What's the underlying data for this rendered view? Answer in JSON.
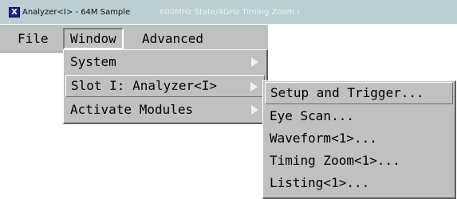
{
  "titlebar": {
    "title": "Analyzer<I> - 64M Sample",
    "subtitle": "600MHz State/4GHz Timing Zoom I",
    "icon": "x-window-icon",
    "colors": {
      "background": "#b9cfd1",
      "icon_bg": "#1a1f8a"
    }
  },
  "menubar": {
    "items": [
      {
        "label": "File"
      },
      {
        "label": "Window",
        "state": "open"
      },
      {
        "label": "Advanced"
      }
    ]
  },
  "window_menu": {
    "items": [
      {
        "label": "System",
        "has_submenu": true
      },
      {
        "label": "Slot I: Analyzer<I>",
        "has_submenu": true,
        "state": "open"
      },
      {
        "label": "Activate Modules",
        "has_submenu": true
      }
    ]
  },
  "slot_submenu": {
    "items": [
      {
        "label": "Setup and Trigger...",
        "state": "highlighted"
      },
      {
        "label": "Eye Scan..."
      },
      {
        "label": "Waveform<1>..."
      },
      {
        "label": "Timing Zoom<1>..."
      },
      {
        "label": "Listing<1>..."
      }
    ]
  }
}
